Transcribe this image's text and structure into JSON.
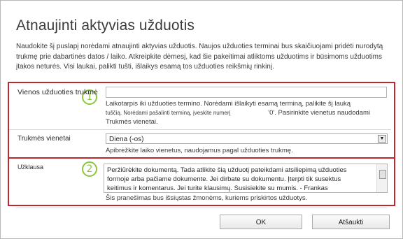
{
  "dialog": {
    "title": "Atnaujinti aktyvias užduotis",
    "description": "Naudokite šį puslapį norėdami atnaujinti aktyvias užduotis. Naujos užduoties terminai bus skaičiuojami pridėti nurodytą trukmę prie dabartinės datos / laiko. Atkreipkite dėmesį, kad šie pakeitimai atliktoms užduotims ir būsimoms užduotims įtakos neturės. Visi laukai, palikti tušti, išlaikys esamą tos užduoties reikšmių rinkinį."
  },
  "duration": {
    "label": "Vienos užduoties trukmė",
    "value": "",
    "help_line1": "Laikotarpis iki užduoties termino. Norėdami išlaikyti esamą terminą, palikite šį lauką",
    "help_line2_small": "tuščią. Norėdami pašalinti terminą, įveskite numerį",
    "help_line2_rest": "'0'. Pasirinkite vienetus naudodami",
    "help_line3": "Trukmės vienetai."
  },
  "units": {
    "label": "Trukmės vienetai",
    "selected": "Diena (-os)",
    "help": "Apibrėžkite laiko vienetus, naudojamus pagal užduoties trukmę."
  },
  "message": {
    "label": "Užklausa",
    "lines": [
      "Peržiūrėkite dokumentą. Tada atlikite šią užduotį pateikdami atsiliepimą užduoties",
      "formoje arba pačiame dokumente. Jei dirbate su dokumentu. Įterpti tik susektus",
      "keitimus ir komentarus. Jei turite klausimų. Susisiekite su mumis. - Frankas"
    ],
    "help": "Šis pranešimas bus išsiųstas žmonėms, kuriems priskirtos užduotys."
  },
  "callouts": {
    "one": "1",
    "two": "2"
  },
  "buttons": {
    "ok": "OK",
    "cancel": "Atšaukti"
  },
  "colors": {
    "highlight": "#c0272d",
    "callout": "#8cc63f"
  }
}
